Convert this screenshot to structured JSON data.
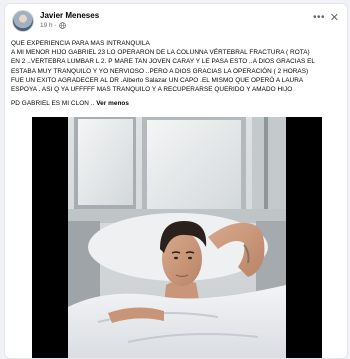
{
  "post": {
    "author": "Javier Meneses",
    "time": "19 h",
    "text_lines": [
      "QUE EXPERIENCIA PARA MAS INTRANQUILA",
      "A MI MENOR HIJO GABRIEL 23  LO OPERARON DE LA COLUNNA  VÉRTEBRAL FRACTURA ( ROTA)",
      "EN 2 ..VERTEBRA LUMBAR L 2.  P MARE TAN JOVEN CARAY Y LE PASA ESTO ..A DIOS GRACIAS EL",
      "ESTABA MUY TRANQUILO Y YO NERVIOSO ..PERO A DIOS GRACIAS LA OPERACIÓN ( 2 HORAS)",
      "FUE UN EXITO  AGRADECER AL DR .Alberto  Salazar  UN CAPO .EL MISMO QUE OPERÓ A LAURA",
      "ESPOYA . ASI Q YA UFFFFF MAS TRANQUILO Y A RECUPERARSE QUERIDO Y AMADO HIJO"
    ],
    "last_line": "PD GABRIEL ES MI CLON ..",
    "see_more": "Ver menos"
  },
  "header": {
    "more_icon": "more-horizontal-icon",
    "close_icon": "close-icon",
    "privacy_icon": "globe-icon",
    "more_label": "•••",
    "close_label": "✕"
  },
  "colors": {
    "background": "#f0f2f5",
    "card": "#ffffff",
    "text": "#050505",
    "secondary_text": "#65676b",
    "media_background": "#000000"
  }
}
